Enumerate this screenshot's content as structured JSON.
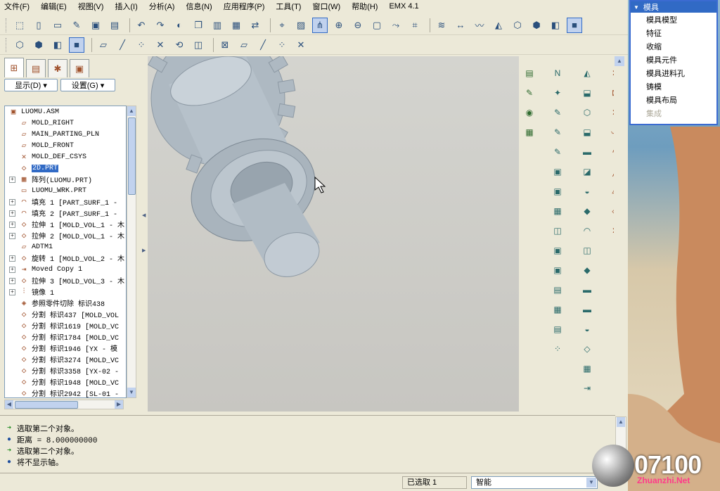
{
  "menubar": [
    "文件(F)",
    "编辑(E)",
    "视图(V)",
    "插入(I)",
    "分析(A)",
    "信息(N)",
    "应用程序(P)",
    "工具(T)",
    "窗口(W)",
    "帮助(H)",
    "EMX 4.1"
  ],
  "toolbar1_icons": [
    "select-icon",
    "new-icon",
    "open-icon",
    "brush-icon",
    "save-icon",
    "save-copy-icon",
    "undo-icon",
    "redo-icon",
    "color-icon",
    "copy-icon",
    "paste-icon",
    "paste-special-icon",
    "regenerate-icon",
    "datum-point-icon",
    "sketch-icon",
    "select-tool-icon",
    "zoom-in-icon",
    "zoom-out-icon",
    "refit-icon",
    "reorient-icon",
    "annotation-icon",
    "layers-icon",
    "dimension-icon",
    "analysis-icon",
    "view-manager-icon",
    "wireframe-icon",
    "hidden-line-icon",
    "no-hidden-icon",
    "shading-icon"
  ],
  "toolbar2_icons": [
    "cube-a-icon",
    "cube-b-icon",
    "cube-c-icon",
    "cube-d-icon",
    "plane-a-icon",
    "axis-a-icon",
    "point-a-icon",
    "csys-a-icon",
    "spin-icon",
    "camera-icon",
    "cancel-icon",
    "plane-b-icon",
    "axis-b-icon",
    "point-b-icon",
    "csys-b-icon"
  ],
  "left_panel": {
    "tabs": [
      "model-tree-tab",
      "layers-tab",
      "favorites-tab",
      "folder-tab"
    ],
    "show_button": "显示(D)",
    "settings_button": "设置(G)",
    "tree": [
      {
        "label": "LUOMU.ASM",
        "exp": false,
        "icon": "▣",
        "root": true
      },
      {
        "label": "MOLD_RIGHT",
        "exp": false,
        "icon": "▱"
      },
      {
        "label": "MAIN_PARTING_PLN",
        "exp": false,
        "icon": "▱"
      },
      {
        "label": "MOLD_FRONT",
        "exp": false,
        "icon": "▱"
      },
      {
        "label": "MOLD_DEF_CSYS",
        "exp": false,
        "icon": "✕"
      },
      {
        "label": "2D.PRT",
        "exp": false,
        "icon": "◇",
        "selected": true
      },
      {
        "label": "阵列(LUOMU.PRT)",
        "exp": true,
        "icon": "▦"
      },
      {
        "label": "LUOMU_WRK.PRT",
        "exp": false,
        "icon": "▭"
      },
      {
        "label": "填充 1 [PART_SURF_1 -",
        "exp": true,
        "icon": "◠"
      },
      {
        "label": "填充 2 [PART_SURF_1 -",
        "exp": true,
        "icon": "◠"
      },
      {
        "label": "拉伸 1 [MOLD_VOL_1 - 木",
        "exp": true,
        "icon": "◇"
      },
      {
        "label": "拉伸 2 [MOLD_VOL_1 - 木",
        "exp": true,
        "icon": "◇"
      },
      {
        "label": "ADTM1",
        "exp": false,
        "icon": "▱"
      },
      {
        "label": "旋转 1 [MOLD_VOL_2 - 木",
        "exp": true,
        "icon": "◇"
      },
      {
        "label": "Moved Copy 1",
        "exp": true,
        "icon": "⇥"
      },
      {
        "label": "拉伸 3 [MOLD_VOL_3 - 木",
        "exp": true,
        "icon": "◇"
      },
      {
        "label": "镜像 1",
        "exp": true,
        "icon": "⫶"
      },
      {
        "label": "参照零件切除 标识438",
        "exp": false,
        "icon": "◈"
      },
      {
        "label": "分割 标识437 [MOLD_VOL",
        "exp": false,
        "icon": "◇"
      },
      {
        "label": "分割 标识1619 [MOLD_VC",
        "exp": false,
        "icon": "◇"
      },
      {
        "label": "分割 标识1784 [MOLD_VC",
        "exp": false,
        "icon": "◇"
      },
      {
        "label": "分割 标识1946 [YX - 模",
        "exp": false,
        "icon": "◇"
      },
      {
        "label": "分割 标识3274 [MOLD_VC",
        "exp": false,
        "icon": "◇"
      },
      {
        "label": "分割 标识3358 [YX-02 -",
        "exp": false,
        "icon": "◇"
      },
      {
        "label": "分割 标识1948 [MOLD_VC",
        "exp": false,
        "icon": "◇"
      },
      {
        "label": "分割 标识2942 [SL-01 -",
        "exp": false,
        "icon": "◇"
      }
    ]
  },
  "messages": [
    {
      "type": "prompt",
      "text": "选取第二个对象。"
    },
    {
      "type": "info",
      "text": "距离 = 8.000000000"
    },
    {
      "type": "prompt",
      "text": "选取第二个对象。"
    },
    {
      "type": "info",
      "text": "将不显示轴。"
    }
  ],
  "status": {
    "selected": "已选取 1",
    "filter": "智能"
  },
  "mold_menu": {
    "title": "模具",
    "items": [
      {
        "label": "模具模型",
        "enabled": true
      },
      {
        "label": "特征",
        "enabled": true
      },
      {
        "label": "收缩",
        "enabled": true
      },
      {
        "label": "模具元件",
        "enabled": true
      },
      {
        "label": "模具进料孔",
        "enabled": true
      },
      {
        "label": "铸模",
        "enabled": true
      },
      {
        "label": "模具布局",
        "enabled": true
      },
      {
        "label": "集成",
        "enabled": false
      }
    ]
  },
  "watermark": {
    "text": "07100",
    "sub": "Zhuanzhi.Net"
  },
  "colors": {
    "accent": "#316ac5",
    "chrome": "#ece9d8",
    "viewport_bg": "#c9c8c3",
    "part": "#b9c4cc"
  }
}
